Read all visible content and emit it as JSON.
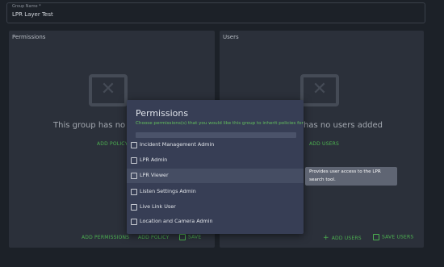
{
  "group_name": {
    "label": "Group Name *",
    "value": "LPR Layer Test"
  },
  "permissions_panel": {
    "title": "Permissions",
    "empty_text": "This group has no pol",
    "add_policy_link": "ADD POLICY",
    "footer": {
      "add_permissions": "ADD PERMISSIONS",
      "add_policy": "ADD POLICY",
      "save": "SAVE"
    }
  },
  "users_panel": {
    "title": "Users",
    "empty_text": "has no users added",
    "add_users_link": "ADD USERS",
    "footer": {
      "add_users": "ADD USERS",
      "save_users": "SAVE USERS"
    }
  },
  "modal": {
    "title": "Permissions",
    "subtitle": "Choose permissions(s) that you would like this group to inherit policies for",
    "options": [
      {
        "label": "Incident Management Admin",
        "checked": false
      },
      {
        "label": "LPR Admin",
        "checked": false
      },
      {
        "label": "LPR Viewer",
        "checked": false,
        "highlighted": true
      },
      {
        "label": "Listen Settings Admin",
        "checked": false
      },
      {
        "label": "Live Link User",
        "checked": false
      },
      {
        "label": "Location and Camera Admin",
        "checked": false
      }
    ]
  },
  "tooltip": {
    "line1": "Provides user access to the LPR",
    "line2": "search tool."
  },
  "colors": {
    "accent": "#4cb050",
    "panel": "#2b303a",
    "modal": "#373e55",
    "background": "#1c2128"
  },
  "icons": {
    "empty_state": "close-icon",
    "add": "plus-icon",
    "save": "save-icon"
  }
}
